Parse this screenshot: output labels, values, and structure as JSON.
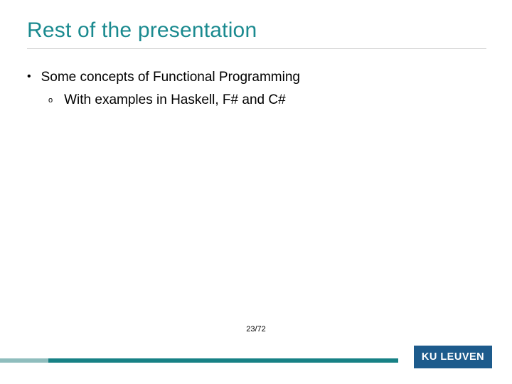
{
  "title": "Rest of the presentation",
  "bullets": {
    "level1": "Some concepts of Functional Programming",
    "level2": "With examples in Haskell, F# and C#"
  },
  "page": "23/72",
  "logo": "KU LEUVEN",
  "colors": {
    "accent": "#1a8a8f",
    "logo_bg": "#1d5b8c"
  }
}
